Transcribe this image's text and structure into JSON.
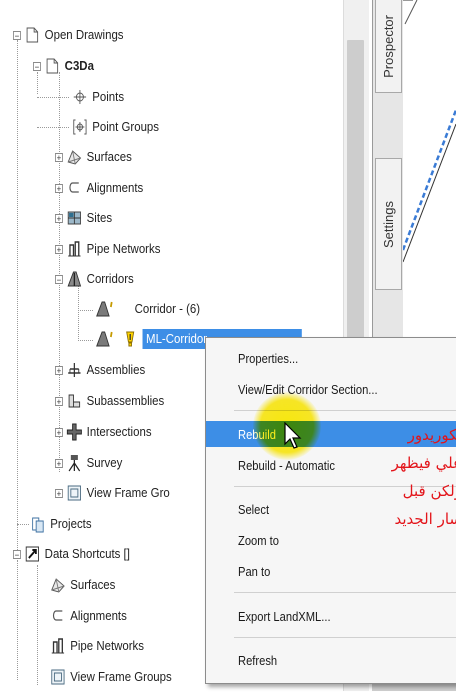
{
  "tree": {
    "items": [
      {
        "label": "Open Drawings",
        "icon": "drawings-folder-icon"
      },
      {
        "label": "C3Da",
        "icon": "drawing-icon"
      },
      {
        "label": "Points",
        "icon": "point-icon"
      },
      {
        "label": "Point Groups",
        "icon": "point-group-icon"
      },
      {
        "label": "Surfaces",
        "icon": "surface-icon"
      },
      {
        "label": "Alignments",
        "icon": "alignment-icon"
      },
      {
        "label": "Sites",
        "icon": "site-icon"
      },
      {
        "label": "Pipe Networks",
        "icon": "pipe-network-icon"
      },
      {
        "label": "Corridors",
        "icon": "corridor-icon"
      },
      {
        "label": "Corridor - (6)",
        "icon": "corridor-item-icon"
      },
      {
        "label": "ML-Corridor",
        "icon": "corridor-item-icon"
      },
      {
        "label": "Assemblies",
        "icon": "assembly-icon"
      },
      {
        "label": "Subassemblies",
        "icon": "subassembly-icon"
      },
      {
        "label": "Intersections",
        "icon": "intersection-icon"
      },
      {
        "label": "Survey",
        "icon": "survey-icon"
      },
      {
        "label": "View Frame Gro",
        "icon": "view-frame-icon"
      },
      {
        "label": "Projects",
        "icon": "projects-icon"
      },
      {
        "label": "Data Shortcuts []",
        "icon": "data-shortcuts-icon"
      },
      {
        "label": "Surfaces",
        "icon": "surface-icon"
      },
      {
        "label": "Alignments",
        "icon": "alignment-icon"
      },
      {
        "label": "Pipe Networks",
        "icon": "pipe-network-icon"
      },
      {
        "label": "View Frame Groups",
        "icon": "view-frame-icon"
      }
    ]
  },
  "side_tabs": {
    "prospector": "Prospector",
    "settings": "Settings"
  },
  "context_menu": {
    "items": [
      {
        "label": "Properties..."
      },
      {
        "label": "View/Edit Corridor Section..."
      },
      {
        "label": "Rebuild"
      },
      {
        "label": "Rebuild - Automatic"
      },
      {
        "label": "Select"
      },
      {
        "label": "Zoom to"
      },
      {
        "label": "Pan to"
      },
      {
        "label": "Export LandXML..."
      },
      {
        "label": "Refresh"
      }
    ]
  },
  "annotation": {
    "lines": [
      "لكوريدور",
      "علي فيظهر",
      "ولكن قبل",
      "سار الجديد"
    ],
    "color": "#e3141a"
  },
  "colors": {
    "selection": "#3d8ee6",
    "highlight_circle": "#ffeb00"
  }
}
